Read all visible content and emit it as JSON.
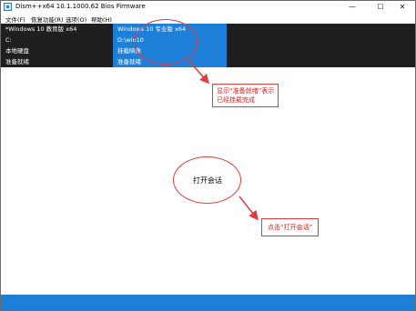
{
  "window": {
    "title": "Dism++x64 10.1.1000.62 Bios Firmware",
    "minimize_glyph": "—",
    "maximize_glyph": "☐",
    "close_glyph": "✕"
  },
  "menu": [
    {
      "label": "文件(F)"
    },
    {
      "label": "恢复功能(R)"
    },
    {
      "label": "选项(O)"
    },
    {
      "label": "帮助(H)"
    }
  ],
  "sessions": [
    {
      "name": "*Windows 10 教育版 x64",
      "path": "C:",
      "type": "本地硬盘",
      "status": "准备就绪",
      "active": false
    },
    {
      "name": "Windows 10 专业版 x64",
      "path": "D:\\win10",
      "type": "挂载映像",
      "status": "准备就绪",
      "active": true
    }
  ],
  "annotations": {
    "callout_ready": [
      "显示“准备就绪”表示",
      "已经挂载完成"
    ],
    "open_session_bubble": "打开会话",
    "callout_open": "点击“打开会话”"
  },
  "colors": {
    "accent": "#1e7fd8",
    "session_bar": "#1f1f1f",
    "annotation": "#e33b3b"
  }
}
